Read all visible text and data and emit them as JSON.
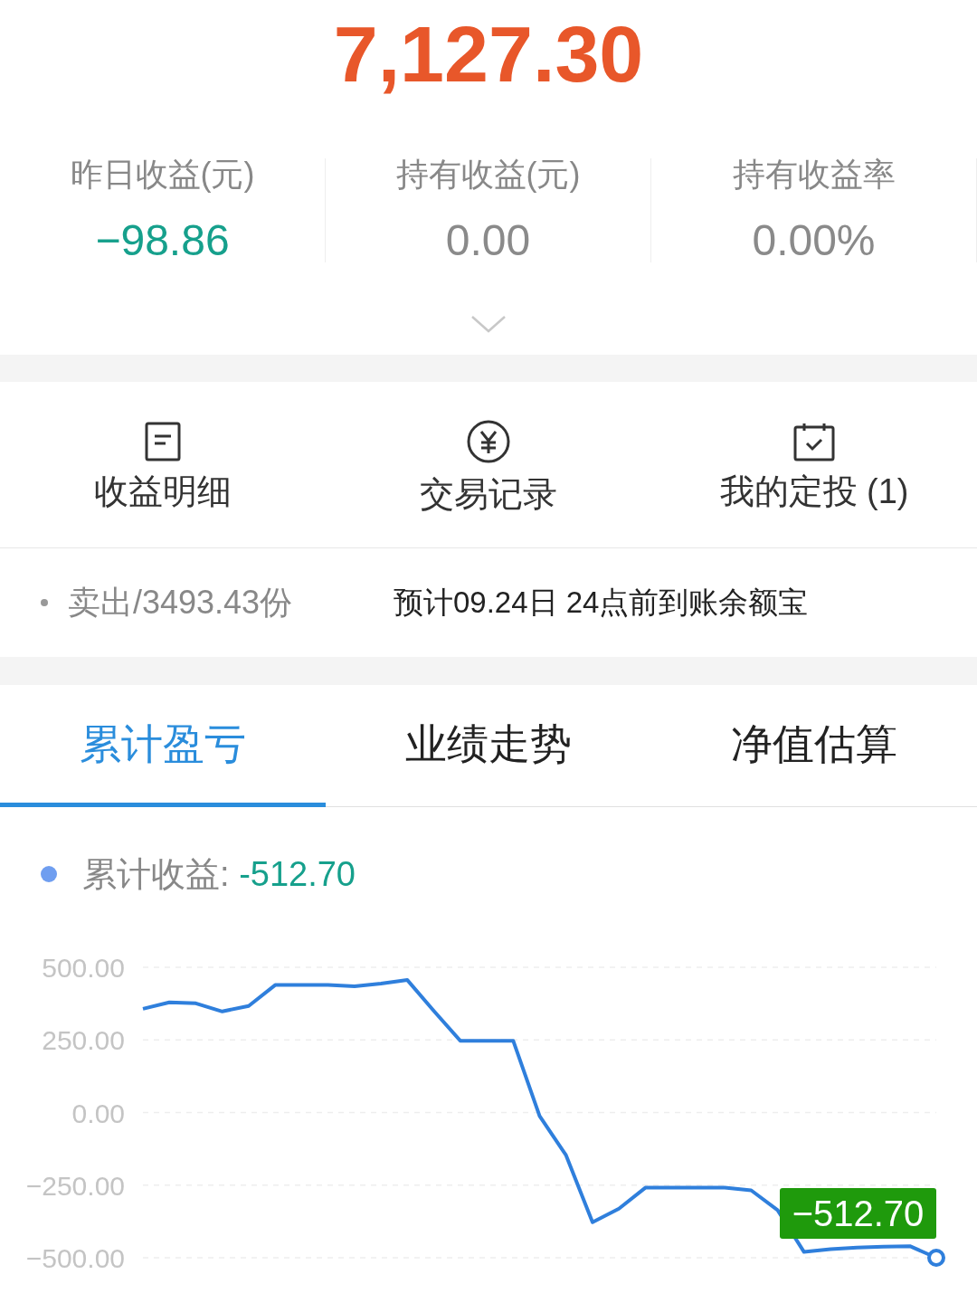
{
  "amount": "7,127.30",
  "stats": [
    {
      "label": "昨日收益(元)",
      "value": "−98.86",
      "kind": "loss"
    },
    {
      "label": "持有收益(元)",
      "value": "0.00",
      "kind": "neutral"
    },
    {
      "label": "持有收益率",
      "value": "0.00%",
      "kind": "neutral"
    }
  ],
  "actions": [
    {
      "label": "收益明细",
      "kind": "document"
    },
    {
      "label": "交易记录",
      "kind": "yen"
    },
    {
      "label": "我的定投 (1)",
      "kind": "calendar"
    }
  ],
  "notice": {
    "status": "卖出/3493.43份",
    "message": "预计09.24日 24点前到账余额宝"
  },
  "tabs": [
    {
      "label": "累计盈亏",
      "selected": true
    },
    {
      "label": "业绩走势",
      "selected": false
    },
    {
      "label": "净值估算",
      "selected": false
    }
  ],
  "legend": {
    "separator": ": ",
    "value": "-512.70",
    "color": "#6f9ef0"
  },
  "tooltip": "−512.70",
  "chart_data": {
    "type": "line",
    "grid": true,
    "ylim": [
      -500,
      500
    ],
    "yticks": [
      {
        "value": 500,
        "label": "500.00"
      },
      {
        "value": 250,
        "label": "250.00"
      },
      {
        "value": 0,
        "label": "0.00"
      },
      {
        "value": -250,
        "label": "−250.00"
      },
      {
        "value": -500,
        "label": "−500.00"
      }
    ],
    "series": [
      {
        "name": "累计收益",
        "color": "#2f7fdc",
        "values": [
          357,
          379,
          376,
          348,
          367,
          439,
          439,
          439,
          435,
          444,
          456,
          350,
          247,
          247,
          247,
          -12,
          -147,
          -378,
          -331,
          -259,
          -259,
          -259,
          -259,
          -268,
          -336,
          -480,
          -470,
          -465,
          -462,
          -460,
          -500
        ]
      }
    ]
  }
}
